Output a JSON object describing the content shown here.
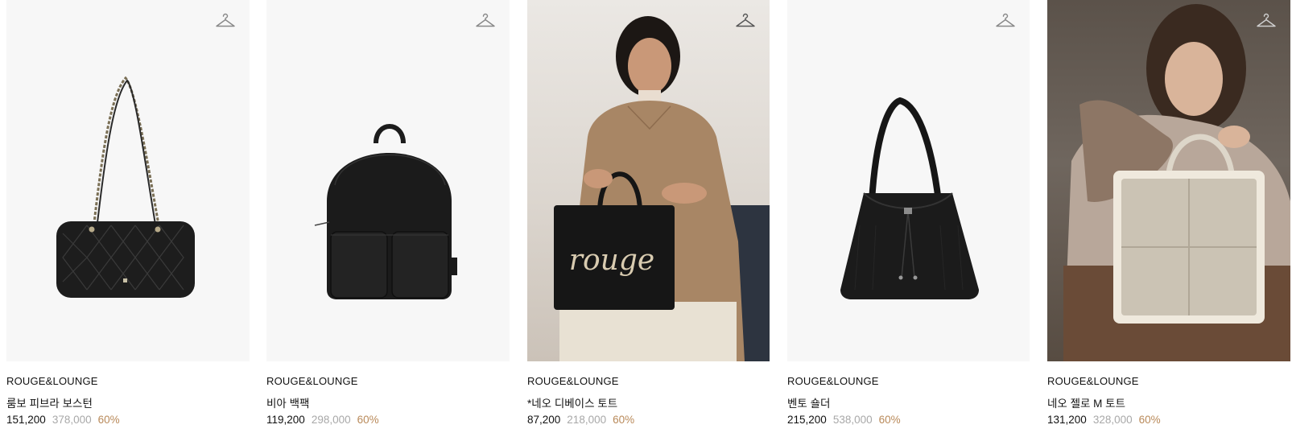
{
  "products": [
    {
      "brand": "ROUGE&LOUNGE",
      "name": "룸보 피브라 보스턴",
      "sale_price": "151,200",
      "original_price": "378,000",
      "discount": "60%",
      "wishlist_icon": "hanger-icon"
    },
    {
      "brand": "ROUGE&LOUNGE",
      "name": "비아 백팩",
      "sale_price": "119,200",
      "original_price": "298,000",
      "discount": "60%",
      "wishlist_icon": "hanger-icon"
    },
    {
      "brand": "ROUGE&LOUNGE",
      "name": "*네오 디베이스 토트",
      "sale_price": "87,200",
      "original_price": "218,000",
      "discount": "60%",
      "wishlist_icon": "hanger-icon",
      "bag_lettering": "rouge"
    },
    {
      "brand": "ROUGE&LOUNGE",
      "name": "벤토 숄더",
      "sale_price": "215,200",
      "original_price": "538,000",
      "discount": "60%",
      "wishlist_icon": "hanger-icon"
    },
    {
      "brand": "ROUGE&LOUNGE",
      "name": "네오 젤로 M 토트",
      "sale_price": "131,200",
      "original_price": "328,000",
      "discount": "60%",
      "wishlist_icon": "hanger-icon"
    }
  ],
  "colors": {
    "discount": "#b98a5a",
    "original_price": "#a8a8a8",
    "image_bg": "#f7f7f7"
  }
}
